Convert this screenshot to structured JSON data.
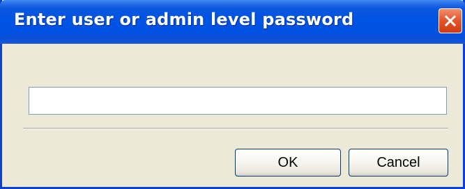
{
  "dialog": {
    "title": "Enter user or admin level password",
    "close_icon": "close-icon",
    "password": {
      "value": "",
      "placeholder": ""
    },
    "ok_label": "OK",
    "cancel_label": "Cancel"
  },
  "colors": {
    "titlebar": "#0054e3",
    "dialog_background": "#ece9d8",
    "close_button": "#e4582c",
    "field_border": "#7f9db9",
    "button_border": "#003c74"
  }
}
